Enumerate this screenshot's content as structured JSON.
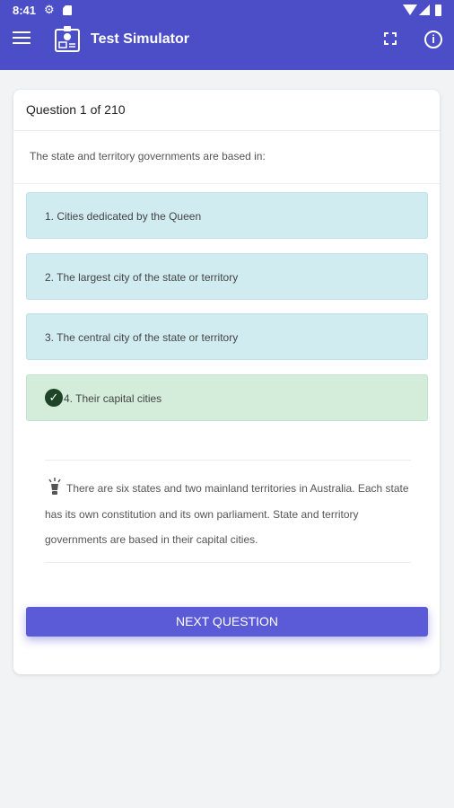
{
  "status_bar": {
    "time": "8:41"
  },
  "app_bar": {
    "title": "Test Simulator"
  },
  "question": {
    "header": "Question 1 of 210",
    "text": "The state and territory governments are based in:"
  },
  "answers": [
    {
      "label": "1. Cities dedicated by the Queen",
      "state": "plain"
    },
    {
      "label": "2. The largest city of the state or territory",
      "state": "plain"
    },
    {
      "label": "3. The central city of the state or territory",
      "state": "plain"
    },
    {
      "label": "4. Their capital cities",
      "state": "correct"
    }
  ],
  "explanation": {
    "text": "There are six states and two mainland territories in Australia. Each state has its own constitution and its own parliament. State and territory governments are based in their capital cities."
  },
  "next_button": {
    "label": "NEXT QUESTION"
  },
  "colors": {
    "app_bar": "#4c4ec7",
    "answer_plain_bg": "#d1ecf1",
    "answer_correct_bg": "#d4edda",
    "next_button": "#5b5bd7"
  },
  "icons": [
    "gear-icon",
    "sd-card-icon",
    "wifi-icon",
    "signal-icon",
    "battery-icon",
    "menu-icon",
    "app-logo-icon",
    "fullscreen-icon",
    "info-icon",
    "check-circle-icon",
    "lightbulb-icon"
  ]
}
